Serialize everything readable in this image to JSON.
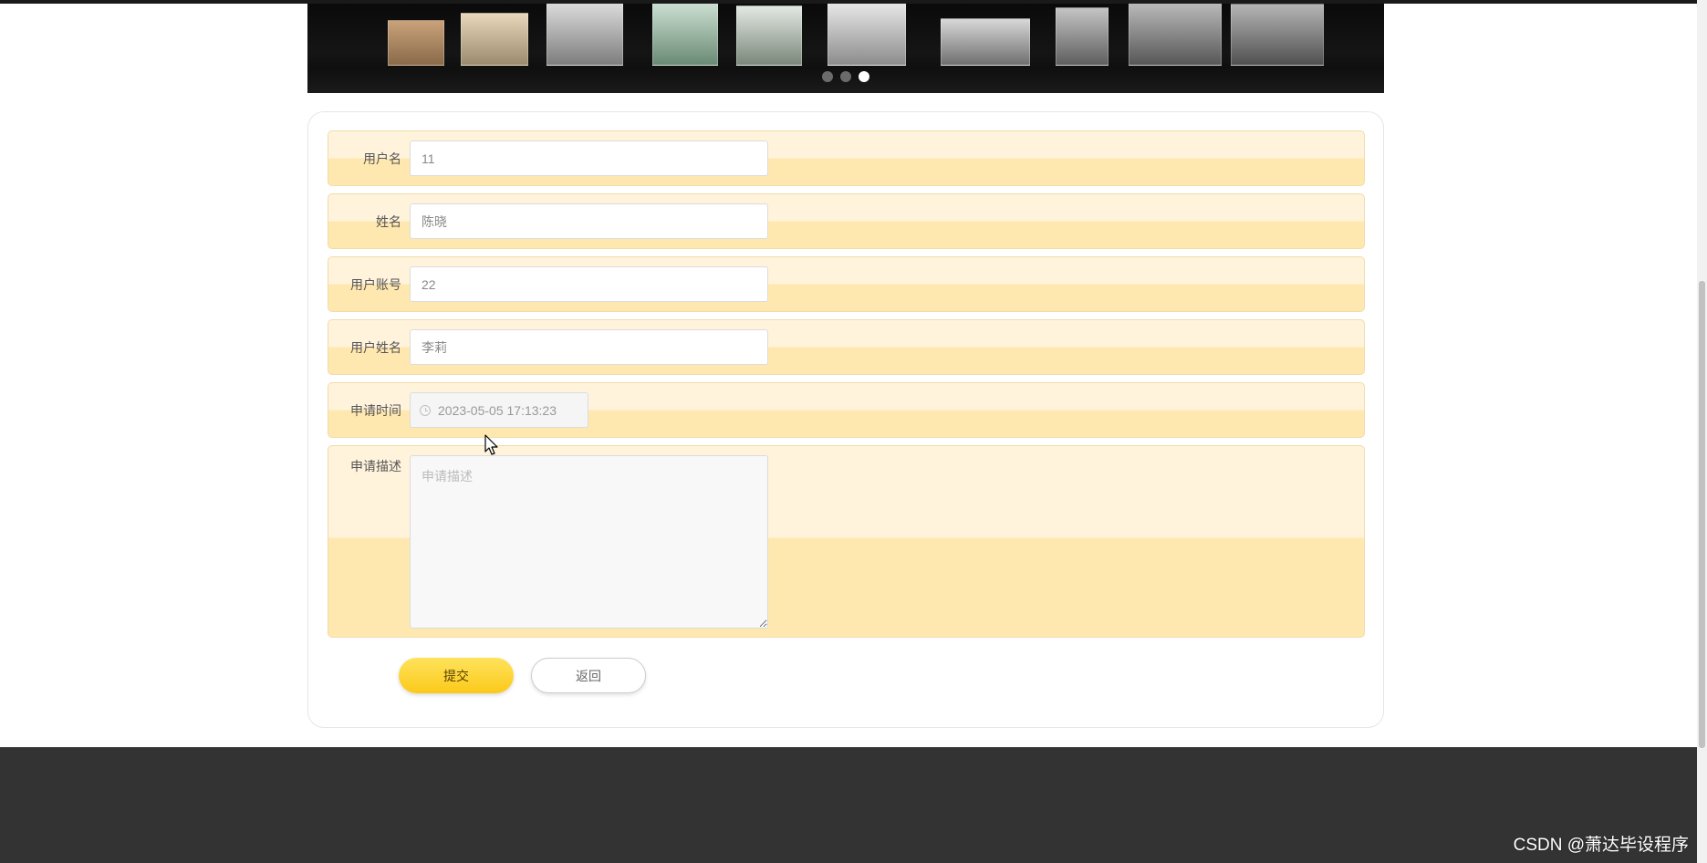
{
  "banner": {
    "slide_count": 3,
    "active_slide": 3
  },
  "form": {
    "fields": [
      {
        "label": "用户名",
        "value": "11"
      },
      {
        "label": "姓名",
        "value": "陈晓"
      },
      {
        "label": "用户账号",
        "value": "22"
      },
      {
        "label": "用户姓名",
        "value": "李莉"
      }
    ],
    "apply_time": {
      "label": "申请时间",
      "value": "2023-05-05 17:13:23",
      "icon": "clock-icon"
    },
    "description": {
      "label": "申请描述",
      "placeholder": "申请描述",
      "value": ""
    },
    "submit_label": "提交",
    "back_label": "返回"
  },
  "watermark": "CSDN @萧达毕设程序",
  "colors": {
    "row_light": "#fff3dc",
    "row_dark": "#ffe8b0",
    "accent": "#fbc91a",
    "footer": "#333333"
  }
}
